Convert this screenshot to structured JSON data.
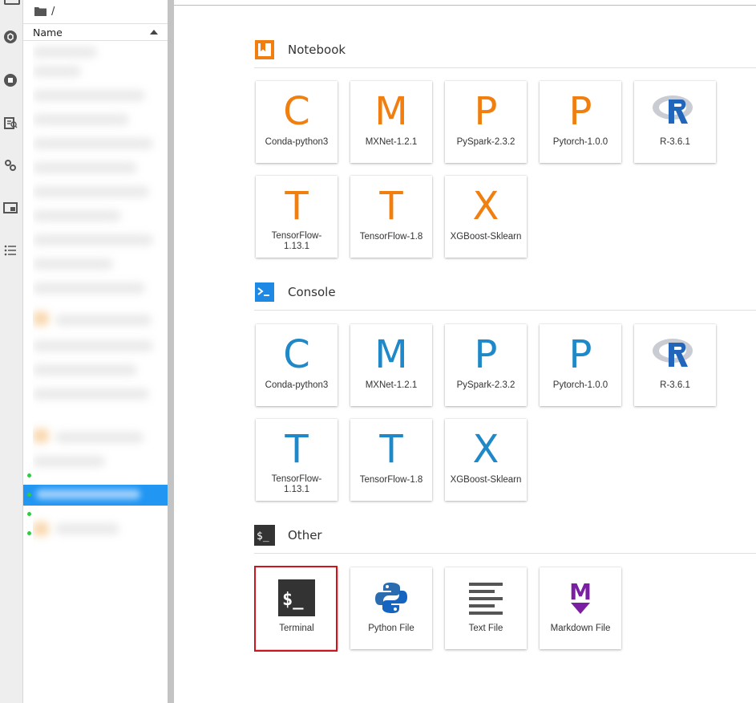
{
  "file_browser": {
    "breadcrumb": "/",
    "column_name": "Name"
  },
  "launcher": {
    "sections": {
      "notebook": {
        "title": "Notebook",
        "items": [
          {
            "glyph": "C",
            "label": "Conda-python3"
          },
          {
            "glyph": "M",
            "label": "MXNet-1.2.1"
          },
          {
            "glyph": "P",
            "label": "PySpark-2.3.2"
          },
          {
            "glyph": "P",
            "label": "Pytorch-1.0.0"
          },
          {
            "glyph": "R",
            "label": "R-3.6.1"
          },
          {
            "glyph": "T",
            "label": "TensorFlow-1.13.1"
          },
          {
            "glyph": "T",
            "label": "TensorFlow-1.8"
          },
          {
            "glyph": "X",
            "label": "XGBoost-Sklearn"
          }
        ]
      },
      "console": {
        "title": "Console",
        "items": [
          {
            "glyph": "C",
            "label": "Conda-python3"
          },
          {
            "glyph": "M",
            "label": "MXNet-1.2.1"
          },
          {
            "glyph": "P",
            "label": "PySpark-2.3.2"
          },
          {
            "glyph": "P",
            "label": "Pytorch-1.0.0"
          },
          {
            "glyph": "R",
            "label": "R-3.6.1"
          },
          {
            "glyph": "T",
            "label": "TensorFlow-1.13.1"
          },
          {
            "glyph": "T",
            "label": "TensorFlow-1.8"
          },
          {
            "glyph": "X",
            "label": "XGBoost-Sklearn"
          }
        ]
      },
      "other": {
        "title": "Other",
        "items": [
          {
            "label": "Terminal"
          },
          {
            "label": "Python File"
          },
          {
            "label": "Text File"
          },
          {
            "label": "Markdown File"
          }
        ]
      }
    },
    "icons": {
      "terminal_glyph": "$_",
      "console_glyph": ">_",
      "markdown_glyph": "M"
    }
  },
  "colors": {
    "notebook_accent": "#f07f10",
    "console_accent": "#1e88c8",
    "selection": "#2196f3",
    "highlight_box": "#d0141b"
  }
}
